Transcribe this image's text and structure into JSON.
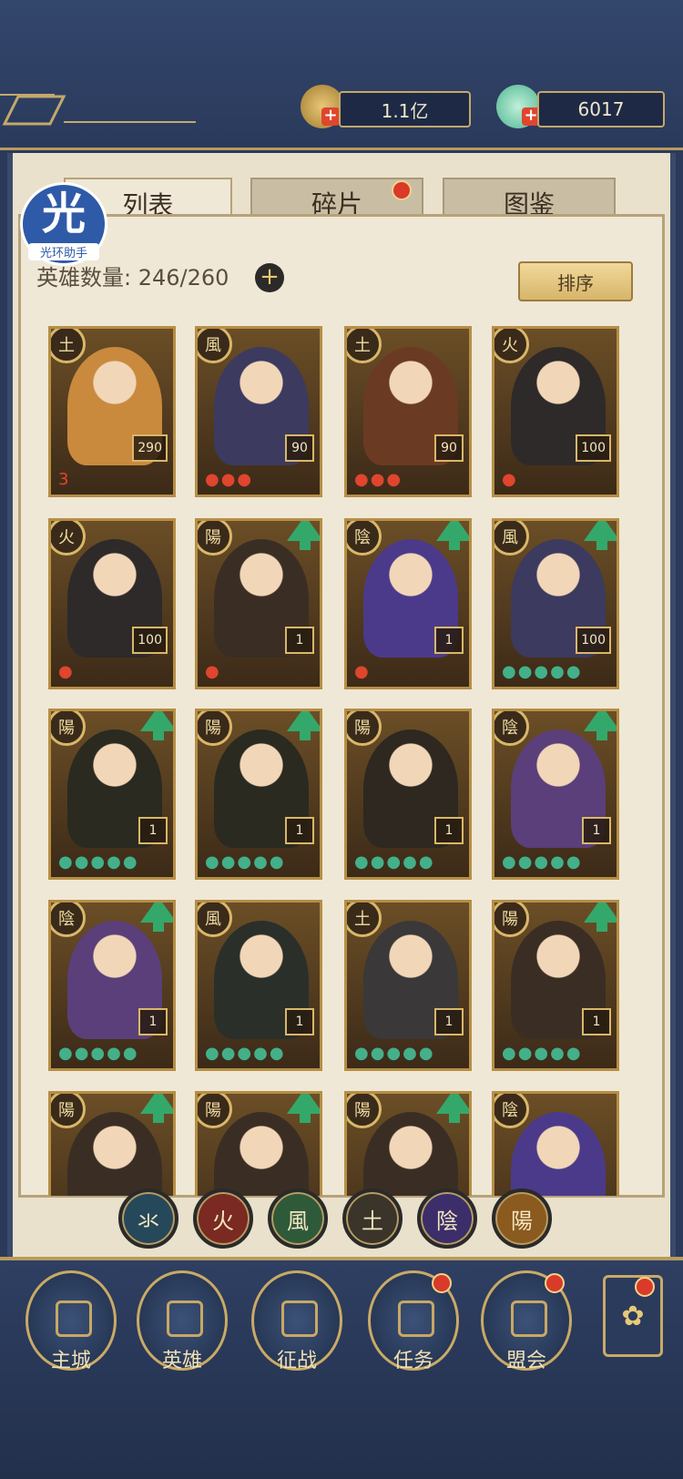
{
  "header": {
    "currency_label": "1.1亿",
    "gem_label": "6017",
    "plus_symbol": "+"
  },
  "tabs": [
    {
      "label": "列表",
      "active": true
    },
    {
      "label": "碎片",
      "active": false,
      "badge": true
    },
    {
      "label": "图鉴",
      "active": false
    }
  ],
  "overlay_logo": {
    "char": "光",
    "text": "光环助手"
  },
  "hero_count_label": "英雄数量: 246/260",
  "sort_label": "排序",
  "elements": {
    "earth": "土",
    "wind": "風",
    "fire": "火",
    "yang": "陽",
    "yin": "陰",
    "water": "氺"
  },
  "heroes": [
    {
      "element": "土",
      "level": "290",
      "stars": "3",
      "upgrade": false,
      "color": "#c98a3e"
    },
    {
      "element": "風",
      "level": "90",
      "stars": "●●●",
      "upgrade": false,
      "color": "#3c3a5e"
    },
    {
      "element": "土",
      "level": "90",
      "stars": "●●●",
      "upgrade": false,
      "color": "#6b3a22"
    },
    {
      "element": "火",
      "level": "100",
      "stars": "●",
      "upgrade": false,
      "color": "#2e2a2a"
    },
    {
      "element": "火",
      "level": "100",
      "stars": "●",
      "upgrade": false,
      "color": "#2e2a2a"
    },
    {
      "element": "陽",
      "level": "1",
      "stars": "●",
      "upgrade": true,
      "color": "#3a2e24"
    },
    {
      "element": "陰",
      "level": "1",
      "stars": "●",
      "upgrade": true,
      "color": "#4b3a8a"
    },
    {
      "element": "風",
      "level": "100",
      "stars": "●●●●●",
      "upgrade": true,
      "color": "#3c3a5e"
    },
    {
      "element": "陽",
      "level": "1",
      "stars": "●●●●●",
      "upgrade": true,
      "color": "#2a2a20"
    },
    {
      "element": "陽",
      "level": "1",
      "stars": "●●●●●",
      "upgrade": true,
      "color": "#2a2a20"
    },
    {
      "element": "陽",
      "level": "1",
      "stars": "●●●●●",
      "upgrade": false,
      "color": "#2e2820"
    },
    {
      "element": "陰",
      "level": "1",
      "stars": "●●●●●",
      "upgrade": true,
      "color": "#5a3f7a"
    },
    {
      "element": "陰",
      "level": "1",
      "stars": "●●●●●",
      "upgrade": true,
      "color": "#5a3f7a"
    },
    {
      "element": "風",
      "level": "1",
      "stars": "●●●●●",
      "upgrade": false,
      "color": "#2a2f2a"
    },
    {
      "element": "土",
      "level": "1",
      "stars": "●●●●●",
      "upgrade": false,
      "color": "#3a3838"
    },
    {
      "element": "陽",
      "level": "1",
      "stars": "●●●●●",
      "upgrade": true,
      "color": "#3a2e24"
    },
    {
      "element": "陽",
      "level": "",
      "stars": "",
      "upgrade": true,
      "color": "#3a2e24"
    },
    {
      "element": "陽",
      "level": "",
      "stars": "",
      "upgrade": true,
      "color": "#3a2e24"
    },
    {
      "element": "陽",
      "level": "",
      "stars": "",
      "upgrade": true,
      "color": "#3a2e24"
    },
    {
      "element": "陰",
      "level": "",
      "stars": "",
      "upgrade": false,
      "color": "#4b3a8a"
    }
  ],
  "filter_buttons": [
    {
      "label": "氺",
      "color": "#25485a"
    },
    {
      "label": "火",
      "color": "#7a2a22"
    },
    {
      "label": "風",
      "color": "#2e5a3a"
    },
    {
      "label": "土",
      "color": "#3a342a"
    },
    {
      "label": "陰",
      "color": "#3b2e6a"
    },
    {
      "label": "陽",
      "color": "#8a5a1e"
    }
  ],
  "bottom_nav": [
    {
      "label": "主城",
      "badge": false
    },
    {
      "label": "英雄",
      "badge": false
    },
    {
      "label": "征战",
      "badge": false
    },
    {
      "label": "任务",
      "badge": true
    },
    {
      "label": "盟会",
      "badge": true
    }
  ],
  "side_icon": "✿"
}
